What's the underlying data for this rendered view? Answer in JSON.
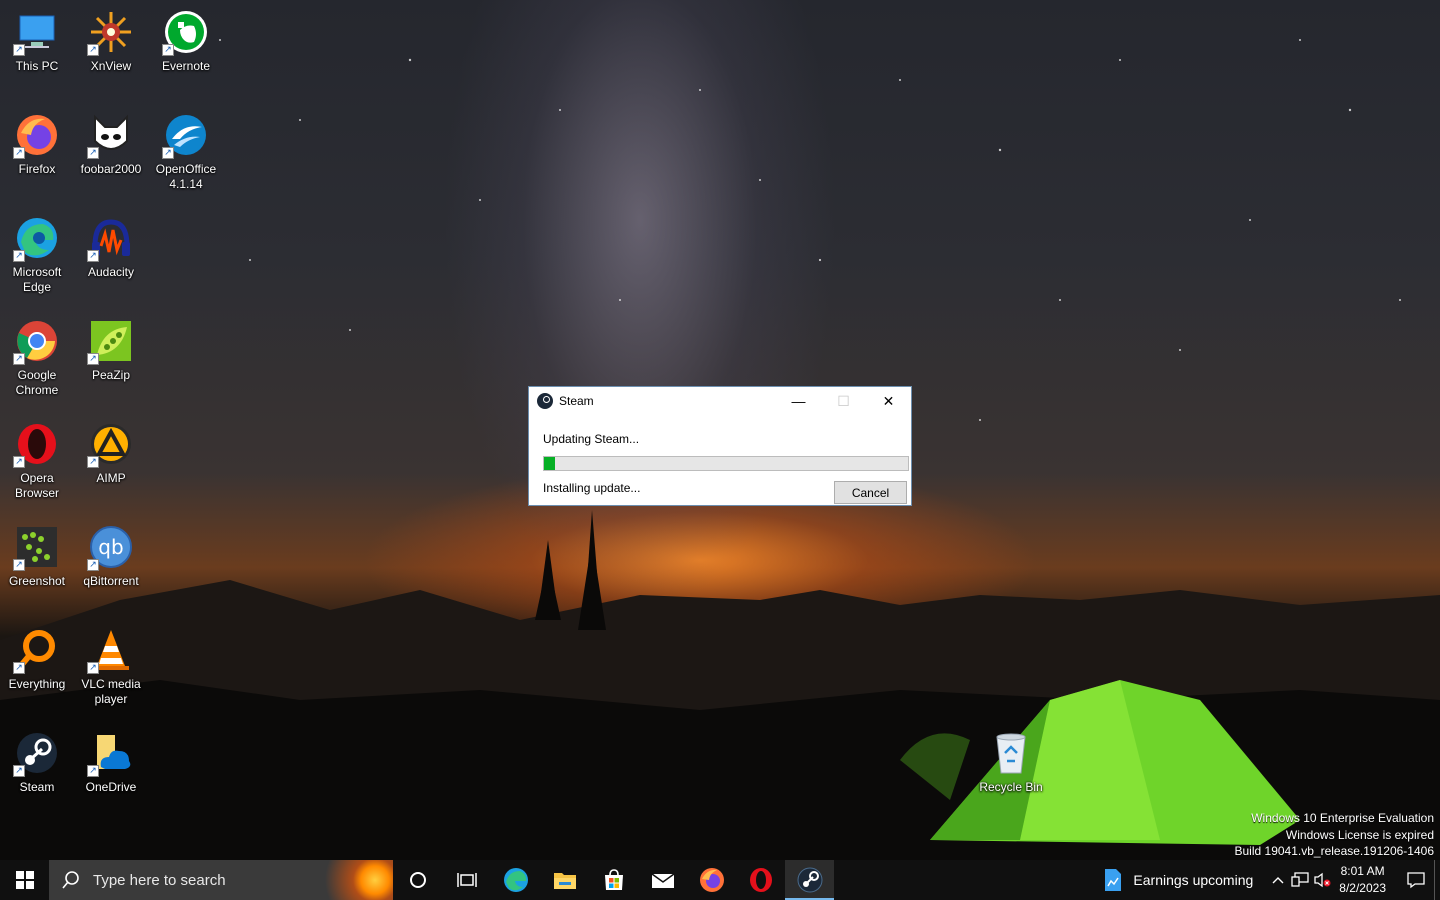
{
  "desktop": {
    "icons": [
      {
        "label": "This PC",
        "icon": "this-pc-icon"
      },
      {
        "label": "XnView",
        "icon": "xnview-icon"
      },
      {
        "label": "Evernote",
        "icon": "evernote-icon"
      },
      {
        "label": "Firefox",
        "icon": "firefox-icon"
      },
      {
        "label": "foobar2000",
        "icon": "foobar2000-icon"
      },
      {
        "label": "OpenOffice 4.1.14",
        "icon": "openoffice-icon"
      },
      {
        "label": "Microsoft Edge",
        "icon": "edge-icon"
      },
      {
        "label": "Audacity",
        "icon": "audacity-icon"
      },
      {
        "label": "Google Chrome",
        "icon": "chrome-icon"
      },
      {
        "label": "PeaZip",
        "icon": "peazip-icon"
      },
      {
        "label": "Opera Browser",
        "icon": "opera-icon"
      },
      {
        "label": "AIMP",
        "icon": "aimp-icon"
      },
      {
        "label": "Greenshot",
        "icon": "greenshot-icon"
      },
      {
        "label": "qBittorrent",
        "icon": "qbittorrent-icon"
      },
      {
        "label": "Everything",
        "icon": "everything-icon"
      },
      {
        "label": "VLC media player",
        "icon": "vlc-icon"
      },
      {
        "label": "Steam",
        "icon": "steam-icon"
      },
      {
        "label": "OneDrive",
        "icon": "onedrive-icon"
      },
      {
        "label": "Recycle Bin",
        "icon": "recycle-bin-icon"
      }
    ]
  },
  "dialog": {
    "title": "Steam",
    "status": "Updating Steam...",
    "progress": 0.03,
    "substatus": "Installing update...",
    "cancel_label": "Cancel",
    "minimize_glyph": "—",
    "maximize_glyph": "☐",
    "close_glyph": "✕"
  },
  "watermark": {
    "line1": "Windows 10 Enterprise Evaluation",
    "line2": "Windows License is expired",
    "line3": "Build 19041.vb_release.191206-1406"
  },
  "taskbar": {
    "search_placeholder": "Type here to search",
    "pinned": [
      "cortana-icon",
      "task-view-icon",
      "edge-icon",
      "file-explorer-icon",
      "microsoft-store-icon",
      "mail-icon",
      "firefox-icon",
      "opera-icon",
      "steam-icon"
    ],
    "active_app": "steam-icon",
    "news": "Earnings upcoming",
    "time": "8:01 AM",
    "date": "8/2/2023"
  },
  "colors": {
    "progress_fill": "#06b025",
    "taskbar_bg": "#101010",
    "accent": "#76b9ed"
  }
}
